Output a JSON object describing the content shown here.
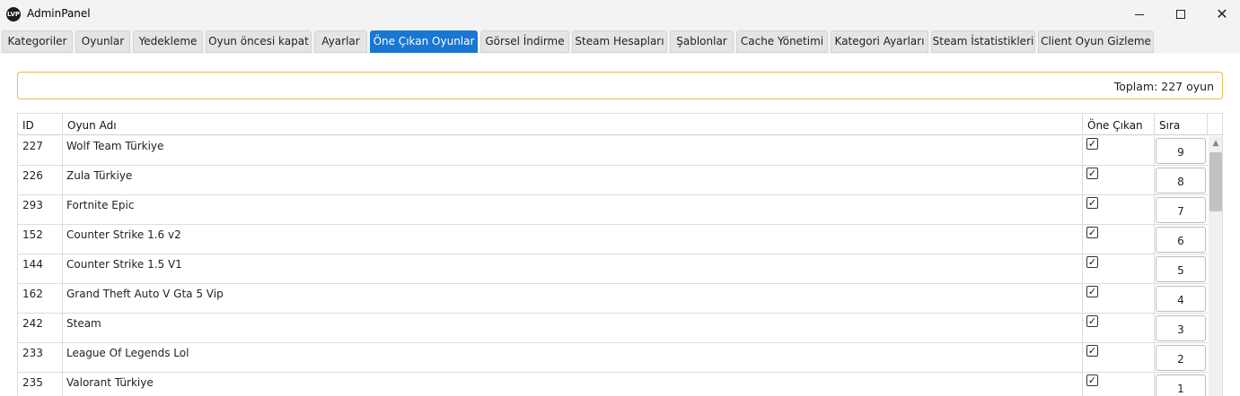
{
  "window": {
    "title": "AdminPanel",
    "icon_text": "LVP",
    "icon_name": "app-logo-icon"
  },
  "tabs": [
    {
      "label": "Kategoriler",
      "active": false
    },
    {
      "label": "Oyunlar",
      "active": false
    },
    {
      "label": "Yedekleme",
      "active": false
    },
    {
      "label": "Oyun öncesi kapat",
      "active": false
    },
    {
      "label": "Ayarlar",
      "active": false
    },
    {
      "label": "Öne Çıkan Oyunlar",
      "active": true
    },
    {
      "label": "Görsel İndirme",
      "active": false
    },
    {
      "label": "Steam Hesapları",
      "active": false
    },
    {
      "label": "Şablonlar",
      "active": false
    },
    {
      "label": "Cache Yönetimi",
      "active": false
    },
    {
      "label": "Kategori Ayarları",
      "active": false
    },
    {
      "label": "Steam İstatistikleri",
      "active": false
    },
    {
      "label": "Client Oyun Gizleme",
      "active": false
    }
  ],
  "summary": {
    "text": "Toplam: 227 oyun"
  },
  "table": {
    "headers": {
      "id": "ID",
      "name": "Oyun Adı",
      "featured": "Öne Çıkan",
      "order": "Sıra"
    },
    "rows": [
      {
        "id": "227",
        "name": "Wolf Team Türkiye",
        "featured": true,
        "order": "9"
      },
      {
        "id": "226",
        "name": "Zula Türkiye",
        "featured": true,
        "order": "8"
      },
      {
        "id": "293",
        "name": "Fortnite Epic",
        "featured": true,
        "order": "7"
      },
      {
        "id": "152",
        "name": "Counter Strike 1.6 v2",
        "featured": true,
        "order": "6"
      },
      {
        "id": "144",
        "name": "Counter Strike 1.5 V1",
        "featured": true,
        "order": "5"
      },
      {
        "id": "162",
        "name": "Grand Theft Auto V Gta 5 Vip",
        "featured": true,
        "order": "4"
      },
      {
        "id": "242",
        "name": "Steam",
        "featured": true,
        "order": "3"
      },
      {
        "id": "233",
        "name": "League Of Legends Lol",
        "featured": true,
        "order": "2"
      },
      {
        "id": "235",
        "name": "Valorant Türkiye",
        "featured": true,
        "order": "1"
      }
    ]
  },
  "colors": {
    "active_tab": "#1976d2",
    "summary_border": "#e6b85c"
  },
  "glyphs": {
    "check": "✓",
    "close": "✕",
    "scroll_up": "▲"
  }
}
